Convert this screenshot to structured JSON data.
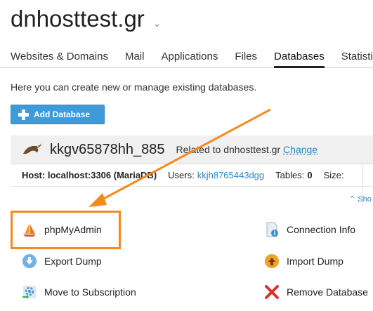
{
  "header": {
    "title": "dnhosttest.gr",
    "caret": "⌄"
  },
  "tabs": [
    {
      "label": "Websites & Domains"
    },
    {
      "label": "Mail"
    },
    {
      "label": "Applications"
    },
    {
      "label": "Files"
    },
    {
      "label": "Databases",
      "active": true
    },
    {
      "label": "Statisti"
    }
  ],
  "intro": "Here you can create new or manage existing databases.",
  "add_button": {
    "label": "Add Database"
  },
  "database": {
    "name": "kkgv65878hh_885",
    "related_label": "Related to dnhosttest.gr",
    "change_link": "Change",
    "host_label": "Host: localhost:3306 (MariaDB)",
    "users_label": "Users:",
    "users_value": "kkjh8765443dgg",
    "tables_label": "Tables:",
    "tables_value": "0",
    "size_label": "Size:",
    "show_more": "⌃ Sho"
  },
  "actions": {
    "phpmyadmin": "phpMyAdmin",
    "connection_info": "Connection Info",
    "export_dump": "Export Dump",
    "import_dump": "Import Dump",
    "move_subscription": "Move to Subscription",
    "remove_database": "Remove Database"
  },
  "colors": {
    "accent": "#3e9ad8",
    "link": "#2d86c3",
    "highlight": "#f5891f",
    "remove": "#d9342b"
  }
}
